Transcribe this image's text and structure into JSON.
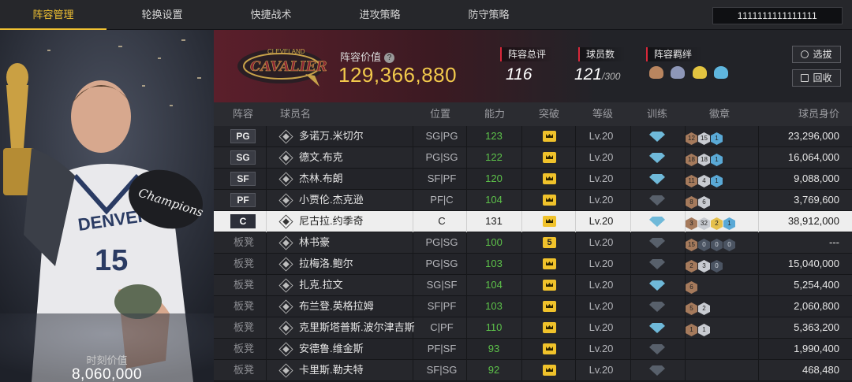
{
  "nav": {
    "tabs": [
      "阵容管理",
      "轮换设置",
      "快捷战术",
      "进攻策略",
      "防守策略"
    ],
    "active_index": 0,
    "account": "1111111111111111"
  },
  "portrait": {
    "moment_label": "时刻价值",
    "moment_value": "8,060,000",
    "jersey_text": "DENVER 15",
    "cap_text": "Champions"
  },
  "team": {
    "logo_text": "CAVALIERS",
    "logo_top_text": "CLEVELAND",
    "value_label": "阵容价值",
    "value": "129,366,880",
    "overall_label": "阵容总评",
    "overall": "116",
    "players_label": "球员数",
    "players_count": "121",
    "players_max": "/300",
    "bond_label": "阵容羁绊",
    "select_button": "选拔",
    "recycle_button": "回收",
    "accent_color": "#d8283a",
    "value_color": "#f2c94c"
  },
  "table": {
    "headers": [
      "阵容",
      "球员名",
      "位置",
      "能力",
      "突破",
      "等级",
      "训练",
      "徽章",
      "球员身价"
    ],
    "rows": [
      {
        "slot": "PG",
        "name": "多诺万.米切尔",
        "pos": "SG|PG",
        "ability": "123",
        "breakthrough": "crown",
        "level": "Lv.20",
        "training": "blue",
        "badges": [
          [
            "12",
            "bronze"
          ],
          [
            "15",
            "silver"
          ],
          [
            "1",
            "blue"
          ]
        ],
        "salary": "23,296,000"
      },
      {
        "slot": "SG",
        "name": "德文.布克",
        "pos": "PG|SG",
        "ability": "122",
        "breakthrough": "crown",
        "level": "Lv.20",
        "training": "blue",
        "badges": [
          [
            "18",
            "bronze"
          ],
          [
            "18",
            "silver"
          ],
          [
            "1",
            "blue"
          ]
        ],
        "salary": "16,064,000"
      },
      {
        "slot": "SF",
        "name": "杰林.布朗",
        "pos": "SF|PF",
        "ability": "120",
        "breakthrough": "crown",
        "level": "Lv.20",
        "training": "blue",
        "badges": [
          [
            "11",
            "bronze"
          ],
          [
            "4",
            "silver"
          ],
          [
            "1",
            "blue"
          ]
        ],
        "salary": "9,088,000"
      },
      {
        "slot": "PF",
        "name": "小贾伦.杰克逊",
        "pos": "PF|C",
        "ability": "104",
        "breakthrough": "crown",
        "level": "Lv.20",
        "training": "dark",
        "badges": [
          [
            "8",
            "bronze"
          ],
          [
            "6",
            "silver"
          ]
        ],
        "salary": "3,769,600"
      },
      {
        "slot": "C",
        "name": "尼古拉.约季奇",
        "pos": "C",
        "ability": "131",
        "breakthrough": "crown",
        "level": "Lv.20",
        "training": "blue",
        "badges": [
          [
            "3",
            "bronze"
          ],
          [
            "32",
            "silver"
          ],
          [
            "2",
            "gold"
          ],
          [
            "1",
            "blue"
          ]
        ],
        "salary": "38,912,000",
        "selected": true
      },
      {
        "slot": "板凳",
        "name": "林书豪",
        "pos": "PG|SG",
        "ability": "100",
        "breakthrough": "5",
        "level": "Lv.20",
        "training": "dark",
        "badges": [
          [
            "15",
            "bronze"
          ],
          [
            "0",
            "dark"
          ],
          [
            "0",
            "dark"
          ],
          [
            "0",
            "dark"
          ]
        ],
        "salary": "---"
      },
      {
        "slot": "板凳",
        "name": "拉梅洛.鲍尔",
        "pos": "PG|SG",
        "ability": "103",
        "breakthrough": "crown",
        "level": "Lv.20",
        "training": "dark",
        "badges": [
          [
            "2",
            "bronze"
          ],
          [
            "3",
            "silver"
          ],
          [
            "0",
            "dark"
          ]
        ],
        "salary": "15,040,000"
      },
      {
        "slot": "板凳",
        "name": "扎克.拉文",
        "pos": "SG|SF",
        "ability": "104",
        "breakthrough": "crown",
        "level": "Lv.20",
        "training": "blue",
        "badges": [
          [
            "6",
            "bronze"
          ]
        ],
        "salary": "5,254,400"
      },
      {
        "slot": "板凳",
        "name": "布兰登.英格拉姆",
        "pos": "SF|PF",
        "ability": "103",
        "breakthrough": "crown",
        "level": "Lv.20",
        "training": "dark",
        "badges": [
          [
            "5",
            "bronze"
          ],
          [
            "2",
            "silver"
          ]
        ],
        "salary": "2,060,800"
      },
      {
        "slot": "板凳",
        "name": "克里斯塔普斯.波尔津吉斯",
        "pos": "C|PF",
        "ability": "110",
        "breakthrough": "crown",
        "level": "Lv.20",
        "training": "blue",
        "badges": [
          [
            "1",
            "bronze"
          ],
          [
            "1",
            "silver"
          ]
        ],
        "salary": "5,363,200"
      },
      {
        "slot": "板凳",
        "name": "安德鲁.维金斯",
        "pos": "PF|SF",
        "ability": "93",
        "breakthrough": "crown",
        "level": "Lv.20",
        "training": "dark",
        "badges": [],
        "salary": "1,990,400"
      },
      {
        "slot": "板凳",
        "name": "卡里斯.勒夫特",
        "pos": "SF|SG",
        "ability": "92",
        "breakthrough": "crown",
        "level": "Lv.20",
        "training": "dark",
        "badges": [],
        "salary": "468,480"
      }
    ]
  }
}
